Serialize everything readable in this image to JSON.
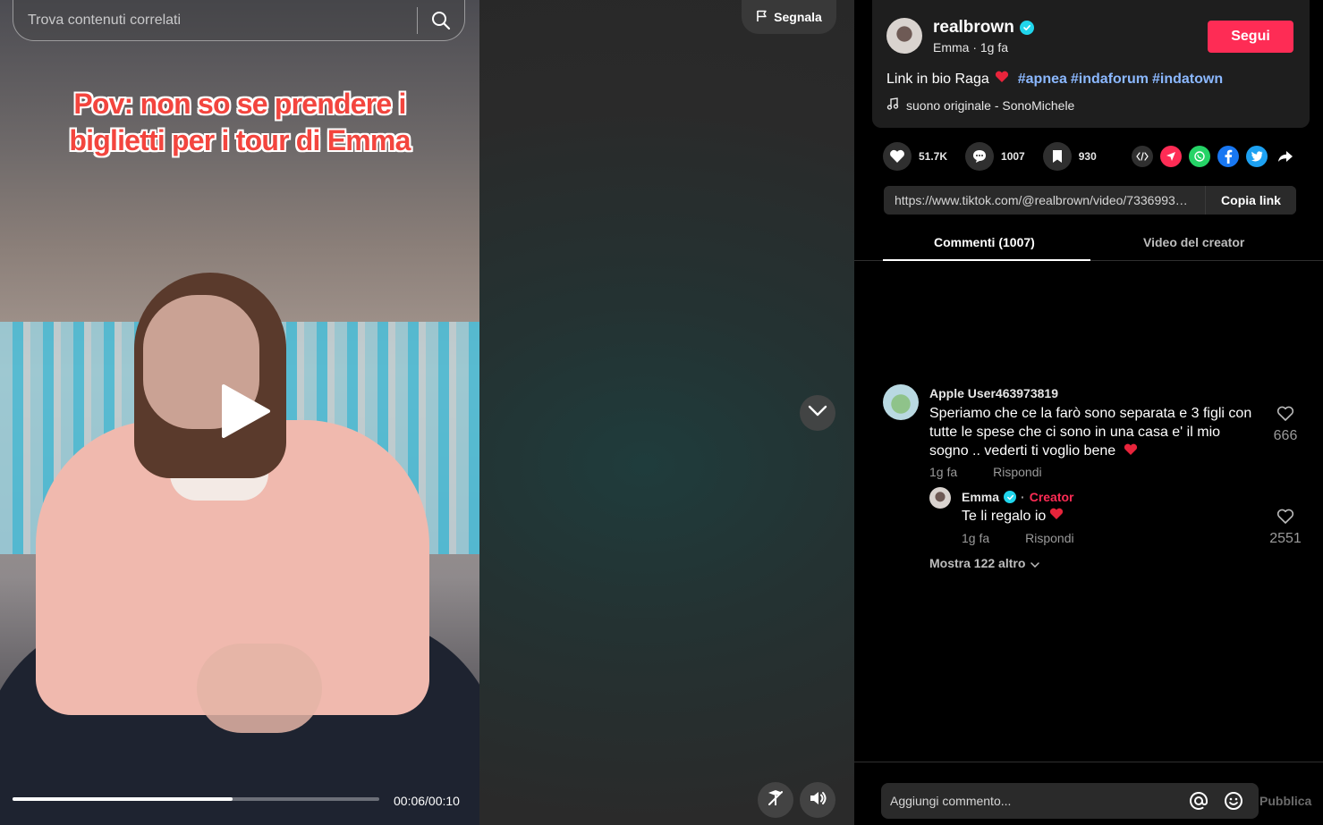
{
  "search": {
    "placeholder": "Trova contenuti correlati"
  },
  "video": {
    "caption_line1": "Pov: non so  se prendere i",
    "caption_line2": "biglietti per i tour di Emma",
    "time": "00:06/00:10",
    "progress": 0.6,
    "report_label": "Segnala"
  },
  "author": {
    "username": "realbrown",
    "subtitle": "Emma · 1g fa",
    "follow_label": "Segui",
    "description": "Link in bio Raga",
    "hashtags": [
      "#apnea",
      "#indaforum",
      "#indatown"
    ],
    "sound": "suono originale - SonoMichele"
  },
  "stats": {
    "likes": "51.7K",
    "comments": "1007",
    "saves": "930"
  },
  "share_icons": [
    "embed-icon",
    "send-icon",
    "whatsapp-icon",
    "facebook-icon",
    "twitter-icon",
    "share-arrow-icon"
  ],
  "link": {
    "url": "https://www.tiktok.com/@realbrown/video/7336993…",
    "copy_label": "Copia link"
  },
  "tabs": {
    "comments": "Commenti (1007)",
    "creator_videos": "Video del creator"
  },
  "comment": {
    "user": "Apple User463973819",
    "text": "Speriamo che ce la farò sono separata e 3 figli con tutte le spese che ci sono in una casa e' il mio sogno .. vederti ti voglio bene",
    "time": "1g fa",
    "reply_label": "Rispondi",
    "likes": "666"
  },
  "reply": {
    "user": "Emma",
    "creator_tag": "Creator",
    "text": "Te li regalo io",
    "time": "1g fa",
    "reply_label": "Rispondi",
    "likes": "2551"
  },
  "show_more": "Mostra 122 altro",
  "composer": {
    "placeholder": "Aggiungi commento...",
    "publish_label": "Pubblica"
  },
  "colors": {
    "accent": "#fe2c55",
    "hashtag": "#8bb8ff",
    "verified": "#20d5ec",
    "caption": "#f3453e"
  }
}
